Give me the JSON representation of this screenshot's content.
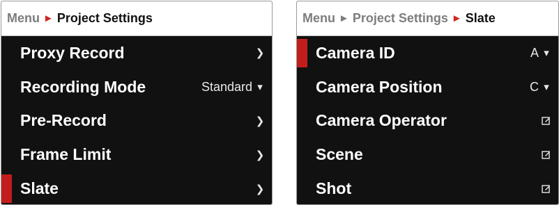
{
  "accent_color": "#c21d1d",
  "left_panel": {
    "breadcrumb": {
      "parent": "Menu",
      "current": "Project Settings"
    },
    "rows": [
      {
        "label": "Proxy Record",
        "value": "",
        "icon": "chevron-right-icon",
        "selected": false
      },
      {
        "label": "Recording Mode",
        "value": "Standard",
        "icon": "dropdown-arrow-icon",
        "selected": false
      },
      {
        "label": "Pre-Record",
        "value": "",
        "icon": "chevron-right-icon",
        "selected": false
      },
      {
        "label": "Frame Limit",
        "value": "",
        "icon": "chevron-right-icon",
        "selected": false
      },
      {
        "label": "Slate",
        "value": "",
        "icon": "chevron-right-icon",
        "selected": true
      }
    ]
  },
  "right_panel": {
    "breadcrumb": {
      "root": "Menu",
      "parent": "Project Settings",
      "current": "Slate"
    },
    "rows": [
      {
        "label": "Camera ID",
        "value": "A",
        "icon": "dropdown-arrow-icon",
        "selected": true
      },
      {
        "label": "Camera Position",
        "value": "C",
        "icon": "dropdown-arrow-icon",
        "selected": false
      },
      {
        "label": "Camera Operator",
        "value": "",
        "icon": "edit-icon",
        "selected": false
      },
      {
        "label": "Scene",
        "value": "",
        "icon": "edit-icon",
        "selected": false
      },
      {
        "label": "Shot",
        "value": "",
        "icon": "edit-icon",
        "selected": false
      }
    ]
  }
}
